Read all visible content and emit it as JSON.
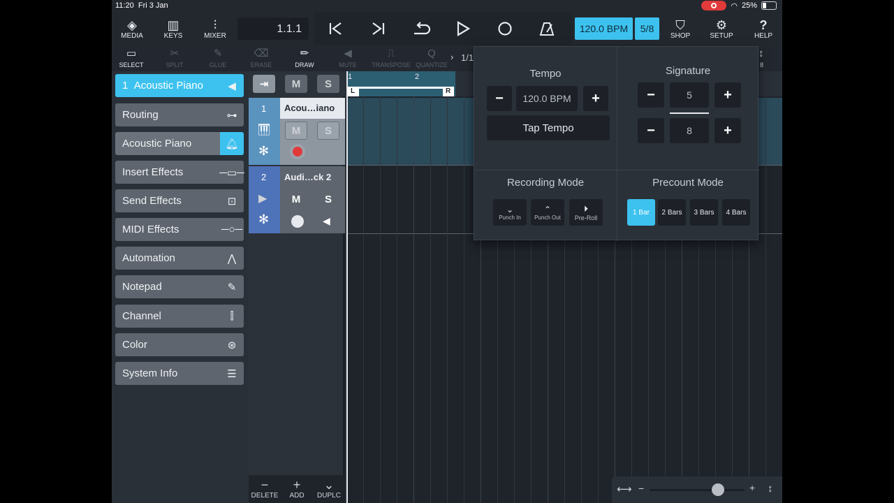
{
  "status": {
    "time": "11:20",
    "date": "Fri 3 Jan",
    "battery": "25%"
  },
  "toolbar": {
    "media": "MEDIA",
    "keys": "KEYS",
    "mixer": "MIXER",
    "position": "1.1.1",
    "bpm": "120.0 BPM",
    "signature": "5/8",
    "shop": "SHOP",
    "setup": "SETUP",
    "help": "HELP"
  },
  "tools": {
    "select": "SELECT",
    "split": "SPLIT",
    "glue": "GLUE",
    "erase": "ERASE",
    "draw": "DRAW",
    "mute": "MUTE",
    "transpose": "TRANSPOSE",
    "quantize": "QUANTIZE",
    "quantize_value": "1/1",
    "right_num": "8"
  },
  "inspector": {
    "header_num": "1",
    "header_label": "Acoustic Piano",
    "items": [
      {
        "label": "Routing",
        "icon": "routing-icon"
      },
      {
        "label": "Acoustic Piano",
        "icon": "metronome-instrument-icon"
      },
      {
        "label": "Insert Effects",
        "icon": "insert-icon"
      },
      {
        "label": "Send Effects",
        "icon": "send-icon"
      },
      {
        "label": "MIDI Effects",
        "icon": "midi-fx-icon"
      },
      {
        "label": "Automation",
        "icon": "automation-icon"
      },
      {
        "label": "Notepad",
        "icon": "notepad-icon"
      },
      {
        "label": "Channel",
        "icon": "channel-icon"
      },
      {
        "label": "Color",
        "icon": "color-icon"
      },
      {
        "label": "System Info",
        "icon": "menu-icon"
      }
    ]
  },
  "tracks": {
    "header_m": "M",
    "header_s": "S",
    "t1": {
      "num": "1",
      "name": "Acou…iano",
      "m": "M",
      "s": "S"
    },
    "t2": {
      "num": "2",
      "name": "Audi…ck 2",
      "m": "M",
      "s": "S"
    }
  },
  "bottom": {
    "delete": "DELETE",
    "add": "ADD",
    "duplicate": "DUPLC"
  },
  "ruler": {
    "bar1": "1",
    "bar2": "2",
    "locator_l": "L",
    "locator_r": "R"
  },
  "popup": {
    "tempo_title": "Tempo",
    "tempo_value": "120.0 BPM",
    "tap_tempo": "Tap Tempo",
    "signature_title": "Signature",
    "sig_num": "5",
    "sig_den": "8",
    "recording_title": "Recording Mode",
    "recording_modes": [
      "Punch In",
      "Punch Out",
      "Pre-Roll"
    ],
    "precount_title": "Precount Mode",
    "precount": [
      "1 Bar",
      "2 Bars",
      "3 Bars",
      "4 Bars"
    ],
    "minus": "−",
    "plus": "+"
  },
  "colors": {
    "accent": "#3dc2ef",
    "record": "#e03a3a"
  }
}
